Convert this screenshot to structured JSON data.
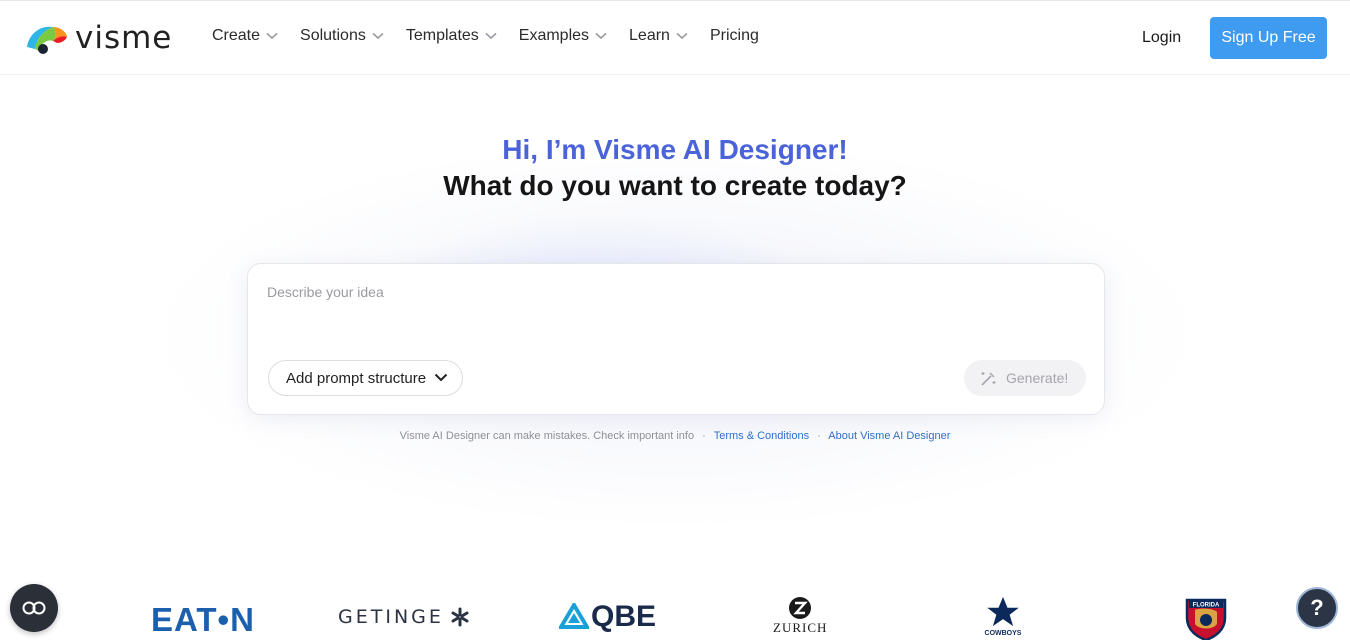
{
  "header": {
    "logo_text": "visme",
    "nav": [
      {
        "label": "Create",
        "has_dropdown": true
      },
      {
        "label": "Solutions",
        "has_dropdown": true
      },
      {
        "label": "Templates",
        "has_dropdown": true
      },
      {
        "label": "Examples",
        "has_dropdown": true
      },
      {
        "label": "Learn",
        "has_dropdown": true
      },
      {
        "label": "Pricing",
        "has_dropdown": false
      }
    ],
    "login_label": "Login",
    "signup_label": "Sign Up Free"
  },
  "hero": {
    "title": "Hi, I’m Visme AI Designer!",
    "subtitle": "What do you want to create today?"
  },
  "prompt": {
    "placeholder": "Describe your idea",
    "value": "",
    "structure_label": "Add prompt structure",
    "generate_label": "Generate!"
  },
  "disclaimer": {
    "text": "Visme AI Designer can make mistakes. Check important info",
    "terms_link": "Terms & Conditions",
    "about_link": "About Visme AI Designer",
    "separator": "·"
  },
  "logos": {
    "partial": "o",
    "eaton": "EAT•N",
    "getinge": "GETINGE",
    "qbe": "QBE",
    "zurich": "ZURICH",
    "cowboys": "COWBOYS",
    "panthers": "FLORIDA"
  },
  "floating": {
    "cookie_label": "CO",
    "help_label": "?"
  },
  "colors": {
    "accent": "#3f9bf0",
    "hero_title": "#4b63d9",
    "link": "#2f6fc9"
  }
}
